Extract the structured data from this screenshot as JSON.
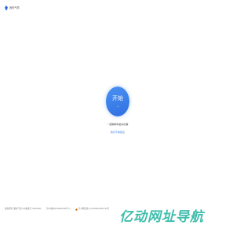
{
  "header": {
    "brand_name": "我的气质",
    "logo_icon": "brand-logo-icon",
    "logo_color": "#2f6fe0"
  },
  "main": {
    "start_button_label": "开始",
    "start_arrow": "→",
    "tagline": "一起聊聊你最好的事",
    "sublink": "我们不收集任"
  },
  "footer": {
    "copyright": "版权所有 我的气质 ICP备案号 2023001",
    "icp": "京ICP备2023000789号-1",
    "police": "京公网安备 11010502051234号",
    "police_icon": "police-badge-icon"
  },
  "watermark": {
    "text": "亿动网址导航"
  },
  "colors": {
    "accent": "#3a7de0",
    "watermark": "#2fb8a6"
  }
}
